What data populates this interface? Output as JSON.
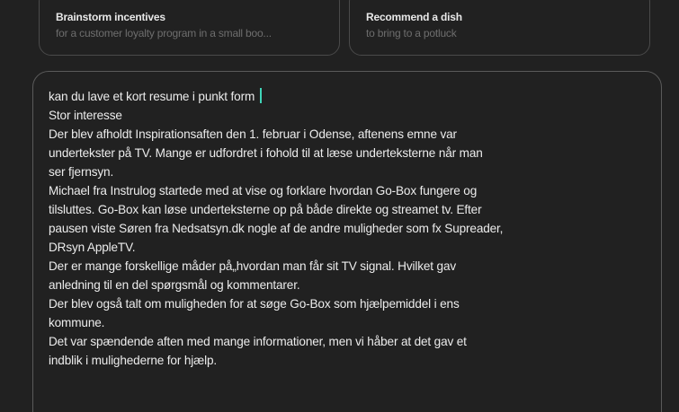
{
  "suggestions": [
    {
      "title": "Brainstorm incentives",
      "subtitle": "for a customer loyalty program in a small boo..."
    },
    {
      "title": "Recommend a dish",
      "subtitle": "to bring to a potluck"
    }
  ],
  "composer": {
    "lines": [
      "kan du lave et kort resume i punkt form",
      "Stor interesse",
      "Der blev afholdt Inspirationsaften den 1. februar i Odense, aftenens emne var",
      "undertekster på TV. Mange er udfordret i fohold til at læse underteksterne når man",
      "ser fjernsyn.",
      "Michael fra Instrulog startede med at vise og forklare hvordan Go-Box fungere og",
      "tilsluttes. Go-Box kan løse underteksterne op på både direkte og streamet tv. Efter",
      "pausen viste Søren fra Nedsatsyn.dk nogle af de andre muligheder som fx Supreader,",
      "DRsyn AppleTV.",
      "Der er mange forskellige måder på„hvordan man får sit TV signal. Hvilket gav",
      "anledning til en del spørgsmål og kommentarer.",
      "Der blev også talt om muligheden for at søge Go-Box som hjælpemiddel i ens",
      "kommune.",
      "Det var spændende aften med mange informationer, men vi håber at det gav et",
      "indblik i mulighederne for hjælp."
    ]
  }
}
